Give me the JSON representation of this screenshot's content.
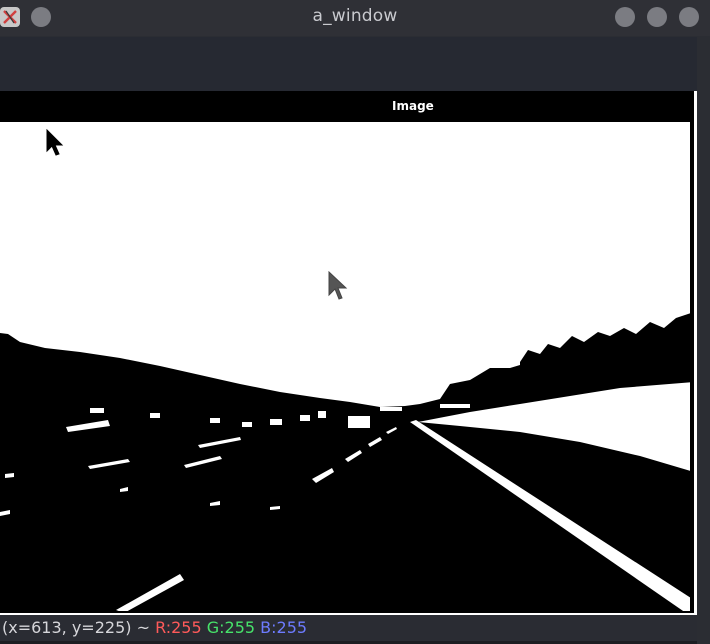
{
  "window": {
    "title": "a_window"
  },
  "image_panel": {
    "label": "Image"
  },
  "status": {
    "coords": "(x=613, y=225) ~",
    "r": "R:255",
    "g": "G:255",
    "b": "B:255"
  },
  "colors": {
    "r_label": "#ff5a5a",
    "g_label": "#47e36a",
    "b_label": "#6d7bff"
  }
}
